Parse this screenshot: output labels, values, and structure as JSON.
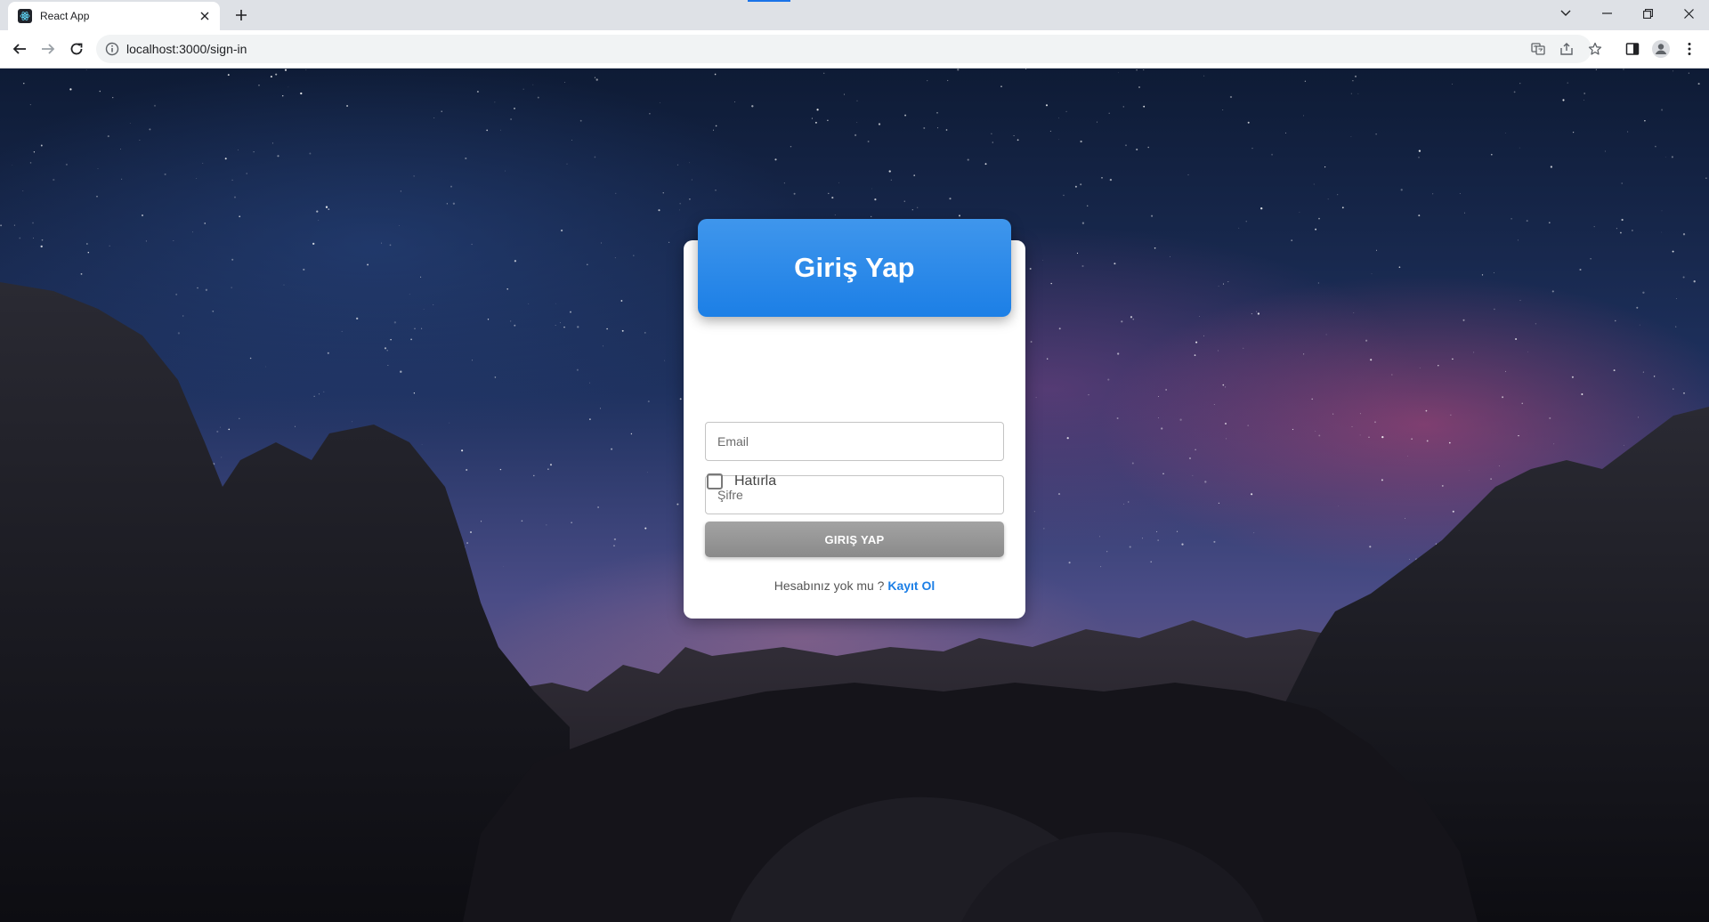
{
  "browser": {
    "tab_title": "React App",
    "url": "localhost:3000/sign-in"
  },
  "login": {
    "title": "Giriş Yap",
    "email_placeholder": "Email",
    "password_placeholder": "Şifre",
    "remember_label": "Hatırla",
    "submit_label": "GIRIŞ YAP",
    "signup_prompt": "Hesabınız yok mu ?",
    "signup_link": "Kayıt Ol"
  },
  "colors": {
    "accent": "#1c7fe6",
    "button_gray": "#969696",
    "card_bg": "#ffffff"
  }
}
